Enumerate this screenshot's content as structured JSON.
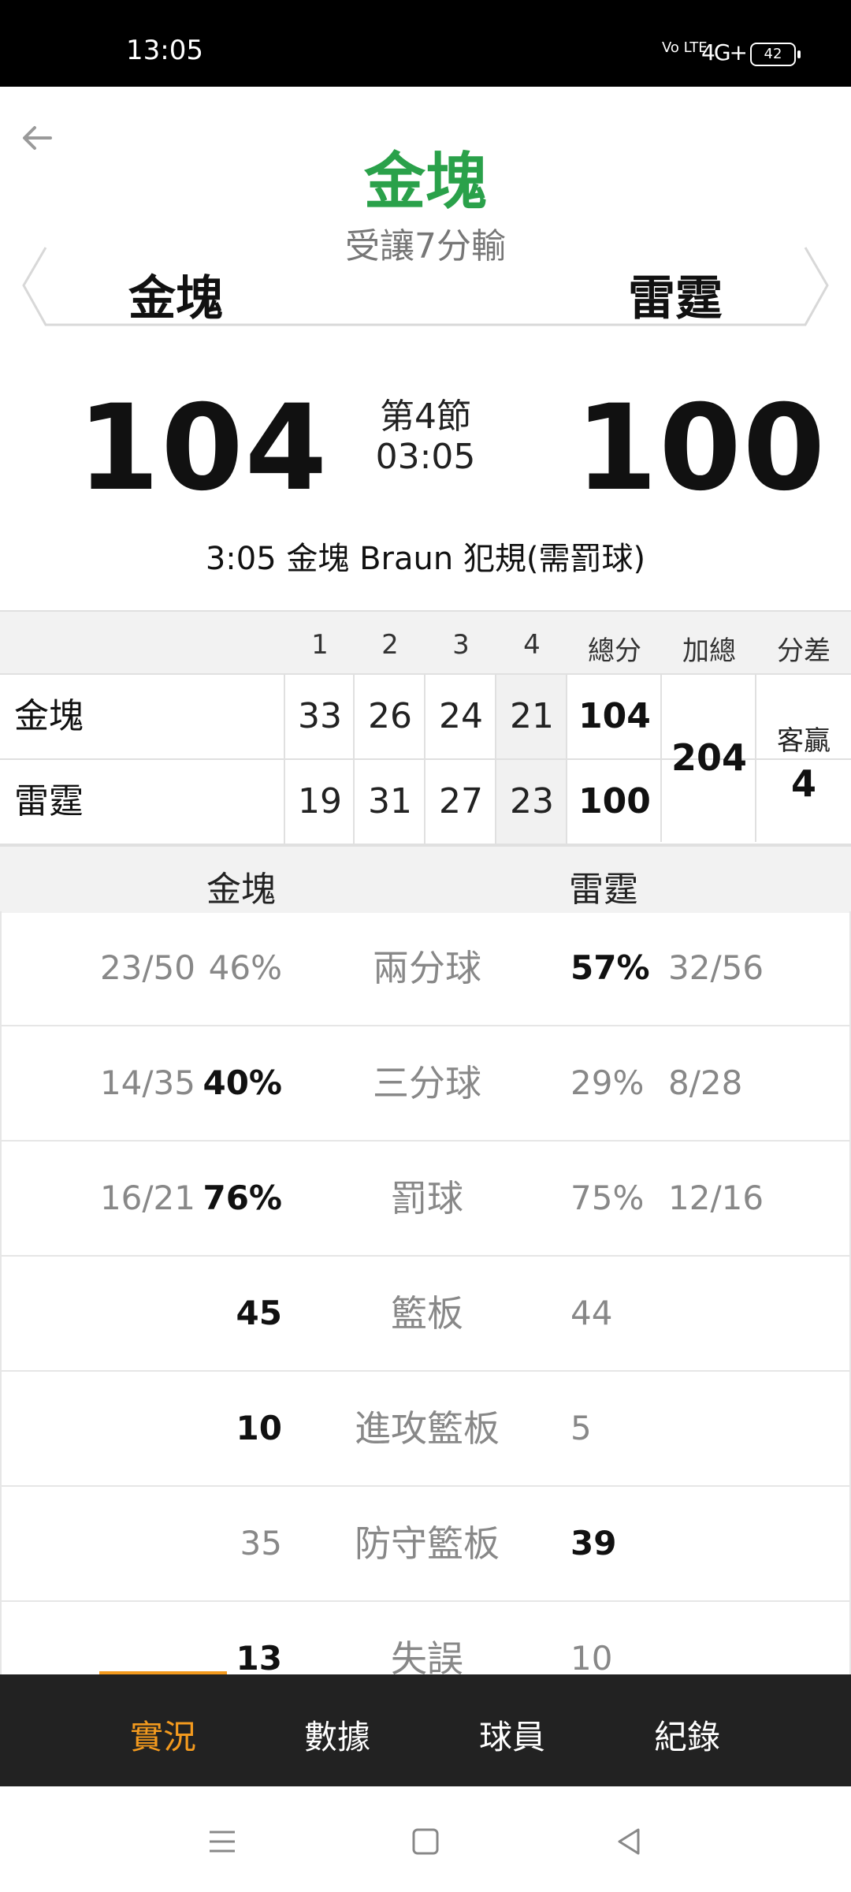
{
  "status_bar": {
    "time": "13:05",
    "network": "Vo LTE",
    "signal": "4G+",
    "battery": "42"
  },
  "header": {
    "title": "金塊",
    "subtitle": "受讓7分輸",
    "team_left": "金塊",
    "team_right": "雷霆"
  },
  "score": {
    "left": "104",
    "right": "100",
    "period": "第4節",
    "clock": "03:05",
    "event": "3:05 金塊 Braun 犯規(需罰球)"
  },
  "quarters": {
    "headers": [
      "1",
      "2",
      "3",
      "4",
      "總分",
      "加總",
      "分差"
    ],
    "rows": [
      {
        "team": "金塊",
        "q": [
          "33",
          "26",
          "24",
          "21"
        ],
        "total": "104"
      },
      {
        "team": "雷霆",
        "q": [
          "19",
          "31",
          "27",
          "23"
        ],
        "total": "100"
      }
    ],
    "combined": "204",
    "diff_label": "客贏",
    "diff_value": "4"
  },
  "stats": {
    "team_left": "金塊",
    "team_right": "雷霆",
    "rows": [
      {
        "label": "兩分球",
        "left_frac": "23/50",
        "left": "46%",
        "right": "57%",
        "right_frac": "32/56",
        "left_bold": false,
        "right_bold": true
      },
      {
        "label": "三分球",
        "left_frac": "14/35",
        "left": "40%",
        "right": "29%",
        "right_frac": "8/28",
        "left_bold": true,
        "right_bold": false
      },
      {
        "label": "罰球",
        "left_frac": "16/21",
        "left": "76%",
        "right": "75%",
        "right_frac": "12/16",
        "left_bold": true,
        "right_bold": false
      },
      {
        "label": "籃板",
        "left_frac": "",
        "left": "45",
        "right": "44",
        "right_frac": "",
        "left_bold": true,
        "right_bold": false
      },
      {
        "label": "進攻籃板",
        "left_frac": "",
        "left": "10",
        "right": "5",
        "right_frac": "",
        "left_bold": true,
        "right_bold": false
      },
      {
        "label": "防守籃板",
        "left_frac": "",
        "left": "35",
        "right": "39",
        "right_frac": "",
        "left_bold": false,
        "right_bold": true
      },
      {
        "label": "失誤",
        "left_frac": "",
        "left": "13",
        "right": "10",
        "right_frac": "",
        "left_bold": true,
        "right_bold": false
      }
    ]
  },
  "tabs": [
    "實況",
    "數據",
    "球員",
    "紀錄"
  ],
  "active_tab": "實況",
  "colors": {
    "title_green": "#2aa14a",
    "accent_orange": "#f39a1e",
    "tabbar_bg": "#222222"
  }
}
